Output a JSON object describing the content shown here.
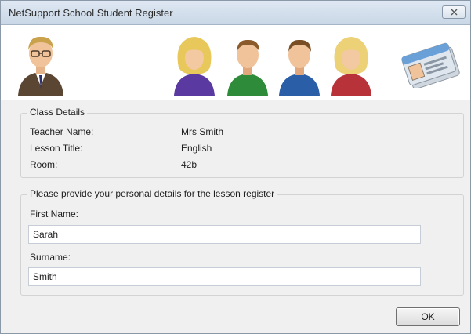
{
  "window": {
    "title": "NetSupport School Student Register"
  },
  "banner": {
    "icons": [
      "teacher-icon",
      "student-yellow-icon",
      "student-green-icon",
      "student-blue-icon",
      "student-red-icon",
      "id-card-icon"
    ],
    "colors": {
      "student_purple": "#5a3aa0",
      "student_green": "#2e8b3a",
      "student_blue": "#2a5fa8",
      "student_red": "#b8323a",
      "teacher_suit": "#5b4634"
    }
  },
  "class_details": {
    "legend": "Class Details",
    "rows": [
      {
        "label": "Teacher Name:",
        "value": "Mrs Smith"
      },
      {
        "label": "Lesson Title:",
        "value": "English"
      },
      {
        "label": "Room:",
        "value": "42b"
      }
    ]
  },
  "personal": {
    "legend": "Please provide your personal details for the lesson register",
    "first_name_label": "First Name:",
    "first_name_value": "Sarah",
    "surname_label": "Surname:",
    "surname_value": "Smith"
  },
  "footer": {
    "ok_label": "OK"
  }
}
